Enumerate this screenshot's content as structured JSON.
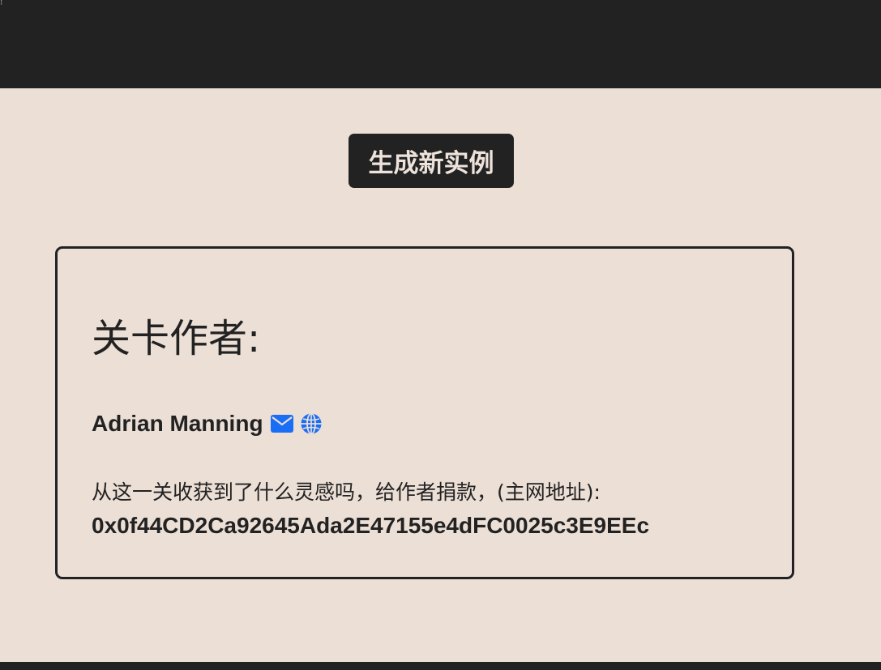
{
  "header": {
    "corner_glyph": "⁝"
  },
  "main": {
    "generate_button_label": "生成新实例",
    "author_card": {
      "title": "关卡作者:",
      "author_name": "Adrian Manning",
      "links": [
        {
          "icon": "envelope-icon"
        },
        {
          "icon": "globe-icon"
        }
      ],
      "donate_text": "从这一关收获到了什么灵感吗，给作者捐款，(主网地址):",
      "donate_address": "0x0f44CD2Ca92645Ada2E47155e4dFC0025c3E9EEc"
    }
  },
  "colors": {
    "background": "#ecdfd6",
    "dark": "#222222",
    "link_blue": "#1a6ef5"
  }
}
